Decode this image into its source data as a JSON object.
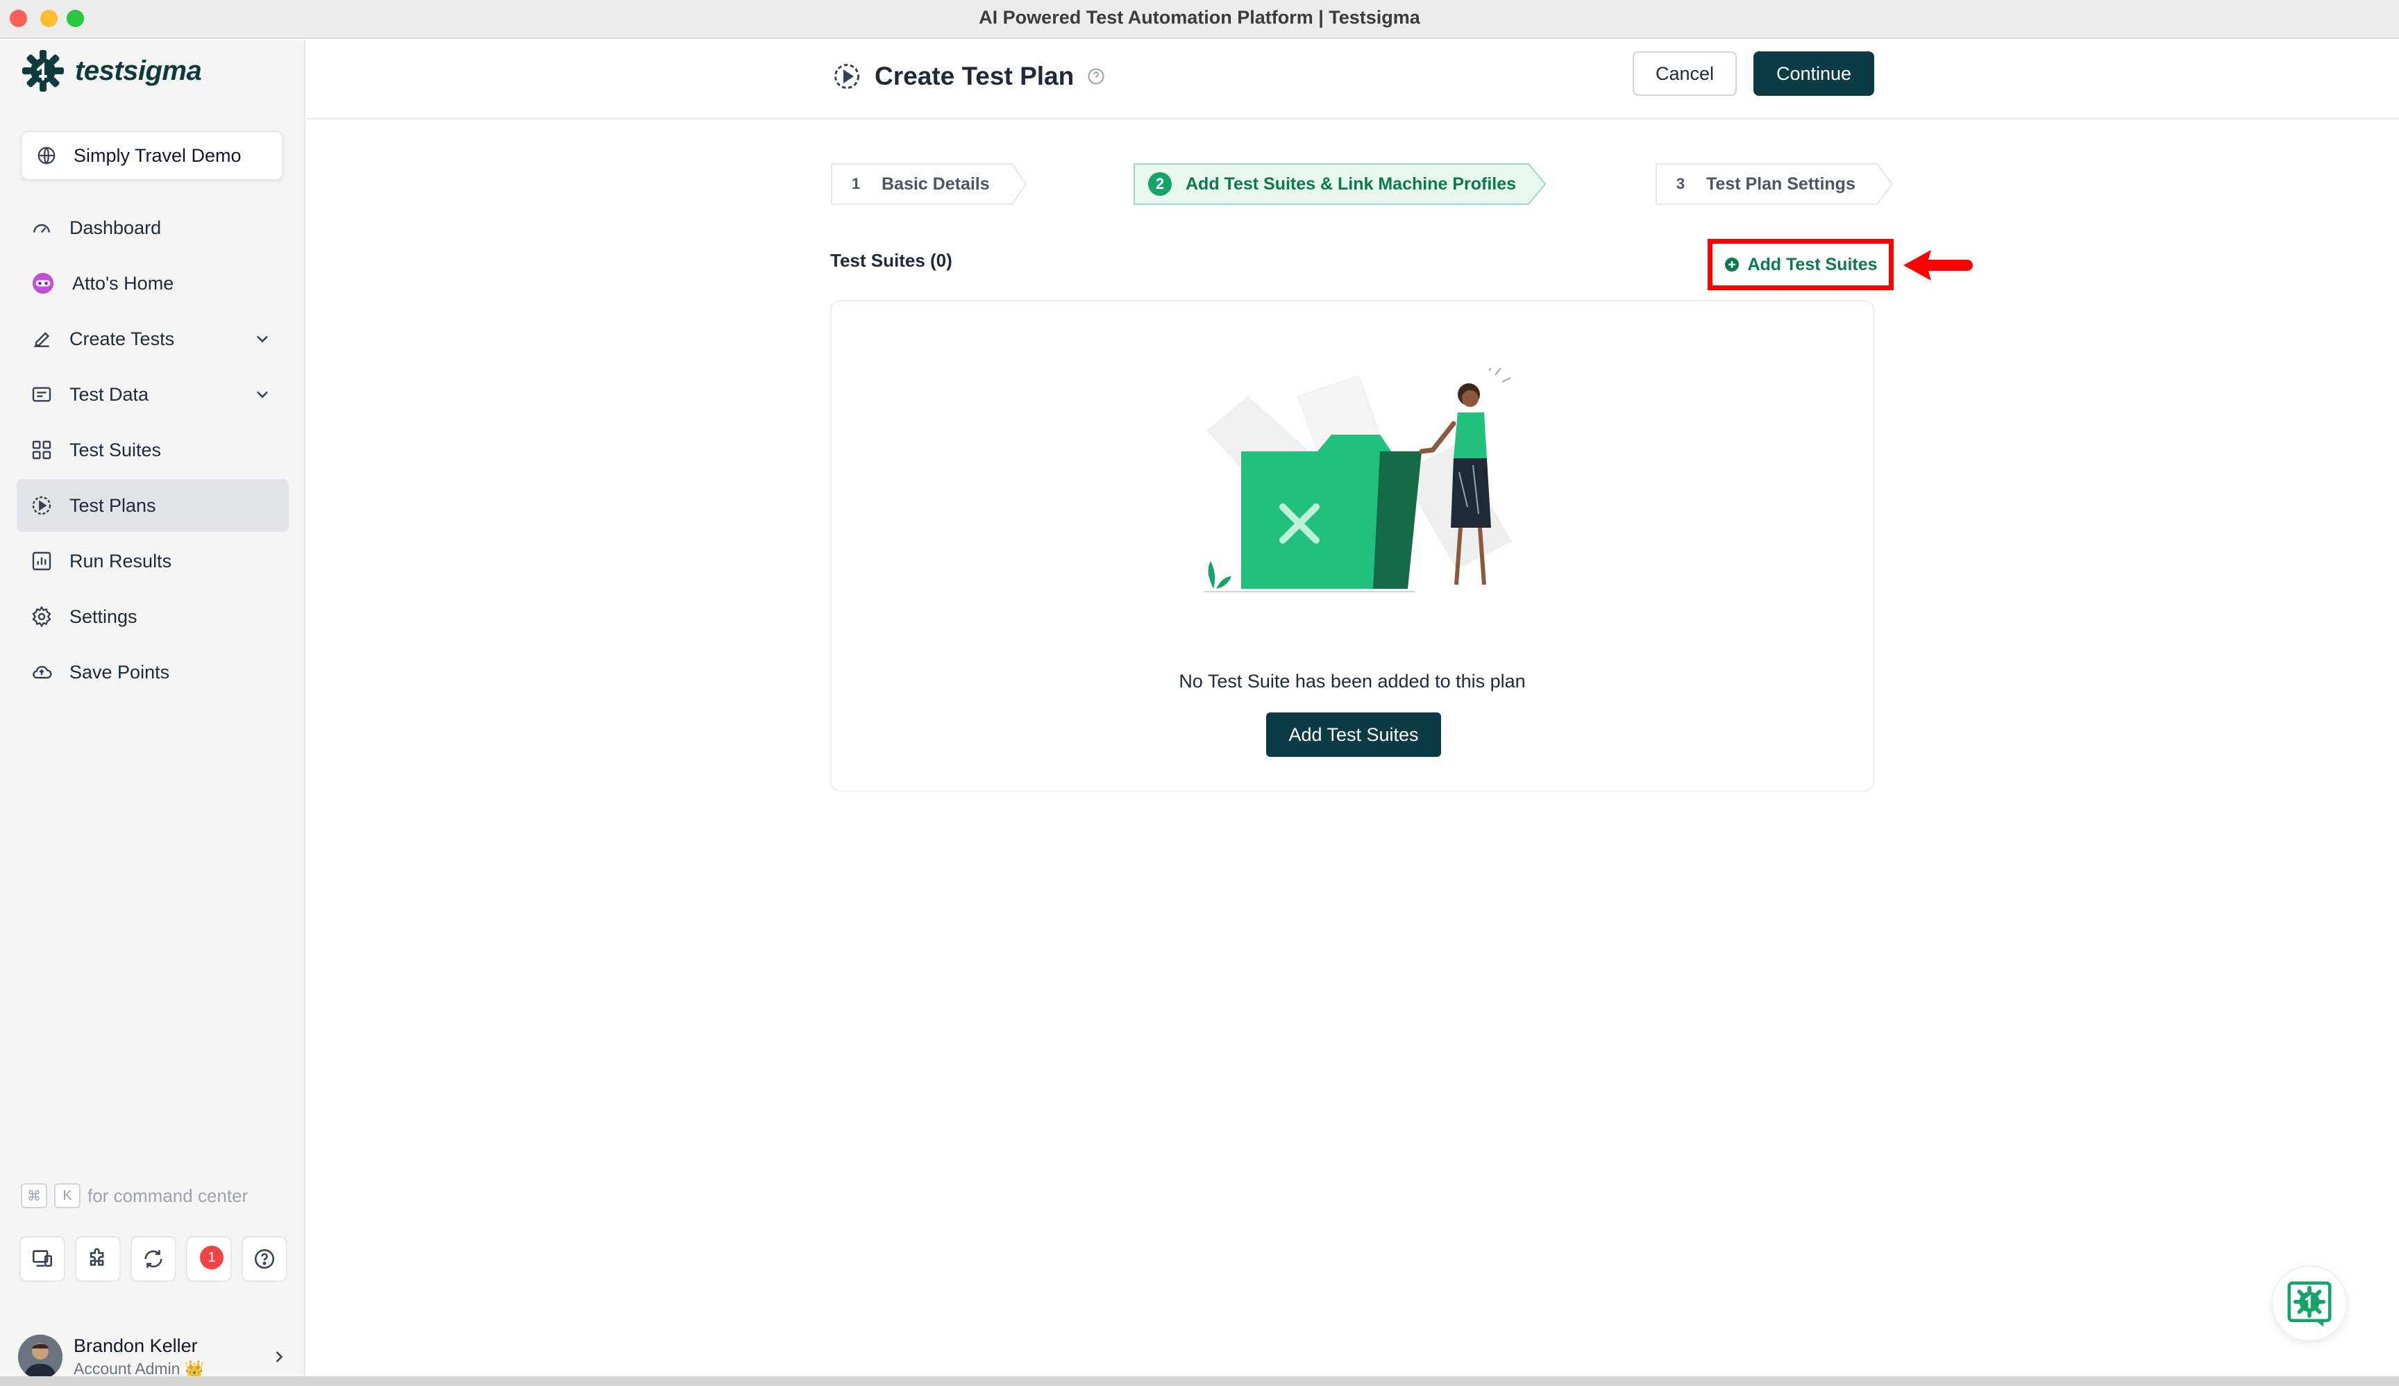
{
  "window": {
    "title": "AI Powered Test Automation Platform | Testsigma"
  },
  "brand": {
    "name": "testsigma",
    "color": "#0f3a3e",
    "accent": "#16a36a"
  },
  "workspace": {
    "label": "Simply Travel Demo"
  },
  "sidebar": {
    "items": [
      {
        "label": "Dashboard",
        "icon": "speedometer-icon"
      },
      {
        "label": "Atto's Home",
        "icon": "atto-icon"
      },
      {
        "label": "Create Tests",
        "icon": "pen-icon",
        "expandable": true
      },
      {
        "label": "Test Data",
        "icon": "data-icon",
        "expandable": true
      },
      {
        "label": "Test Suites",
        "icon": "grid-icon"
      },
      {
        "label": "Test Plans",
        "icon": "play-circle-icon",
        "active": true
      },
      {
        "label": "Run Results",
        "icon": "bar-chart-icon"
      },
      {
        "label": "Settings",
        "icon": "gear-icon"
      },
      {
        "label": "Save Points",
        "icon": "cloud-icon"
      }
    ],
    "command_hint": {
      "key1": "⌘",
      "key2": "K",
      "text": "for command center"
    },
    "notification_count": "1",
    "user": {
      "name": "Brandon Keller",
      "role": "Account Admin",
      "role_badge": "👑"
    }
  },
  "header": {
    "title": "Create Test Plan",
    "cancel_label": "Cancel",
    "continue_label": "Continue"
  },
  "stepper": {
    "steps": [
      {
        "num": "1",
        "label": "Basic Details",
        "state": "done"
      },
      {
        "num": "2",
        "label": "Add Test Suites & Link Machine Profiles",
        "state": "active"
      },
      {
        "num": "3",
        "label": "Test Plan Settings",
        "state": "upcoming"
      }
    ]
  },
  "content": {
    "section_title": "Test Suites (0)",
    "add_link_label": "Add Test Suites",
    "empty_message": "No Test Suite has been added to this plan",
    "add_button_label": "Add Test Suites"
  },
  "colors": {
    "primary_button": "#0d3b45",
    "highlight_red": "#ff0000",
    "folder_green": "#22c07f"
  }
}
